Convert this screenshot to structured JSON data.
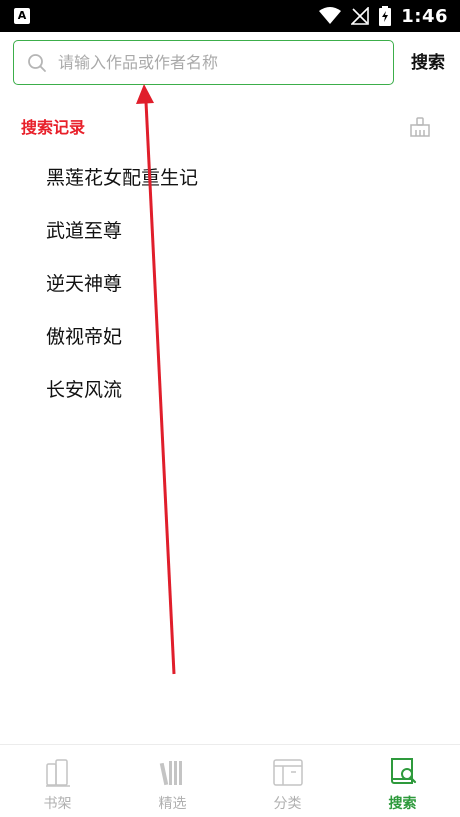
{
  "status_bar": {
    "time": "1:46",
    "left_icon_letter": "A",
    "icons": [
      "wifi-icon",
      "signal-off-icon",
      "battery-charging-icon"
    ]
  },
  "search": {
    "placeholder": "请输入作品或作者名称",
    "value": "",
    "button_label": "搜索",
    "accent_color": "#3cae4a"
  },
  "history": {
    "title": "搜索记录",
    "title_color": "#e8202a",
    "clear_icon": "broom-icon",
    "items": [
      {
        "label": "黑莲花女配重生记"
      },
      {
        "label": "武道至尊"
      },
      {
        "label": "逆天神尊"
      },
      {
        "label": "傲视帝妃"
      },
      {
        "label": "长安风流"
      }
    ]
  },
  "bottom_nav": {
    "items": [
      {
        "label": "书架",
        "icon": "bookshelf-icon",
        "active": false
      },
      {
        "label": "精选",
        "icon": "books-icon",
        "active": false
      },
      {
        "label": "分类",
        "icon": "category-icon",
        "active": false
      },
      {
        "label": "搜索",
        "icon": "book-search-icon",
        "active": true
      }
    ],
    "active_color": "#2e9a3c",
    "inactive_color": "#b0b0b0"
  },
  "annotation": {
    "type": "arrow",
    "color": "#e01e2b"
  }
}
